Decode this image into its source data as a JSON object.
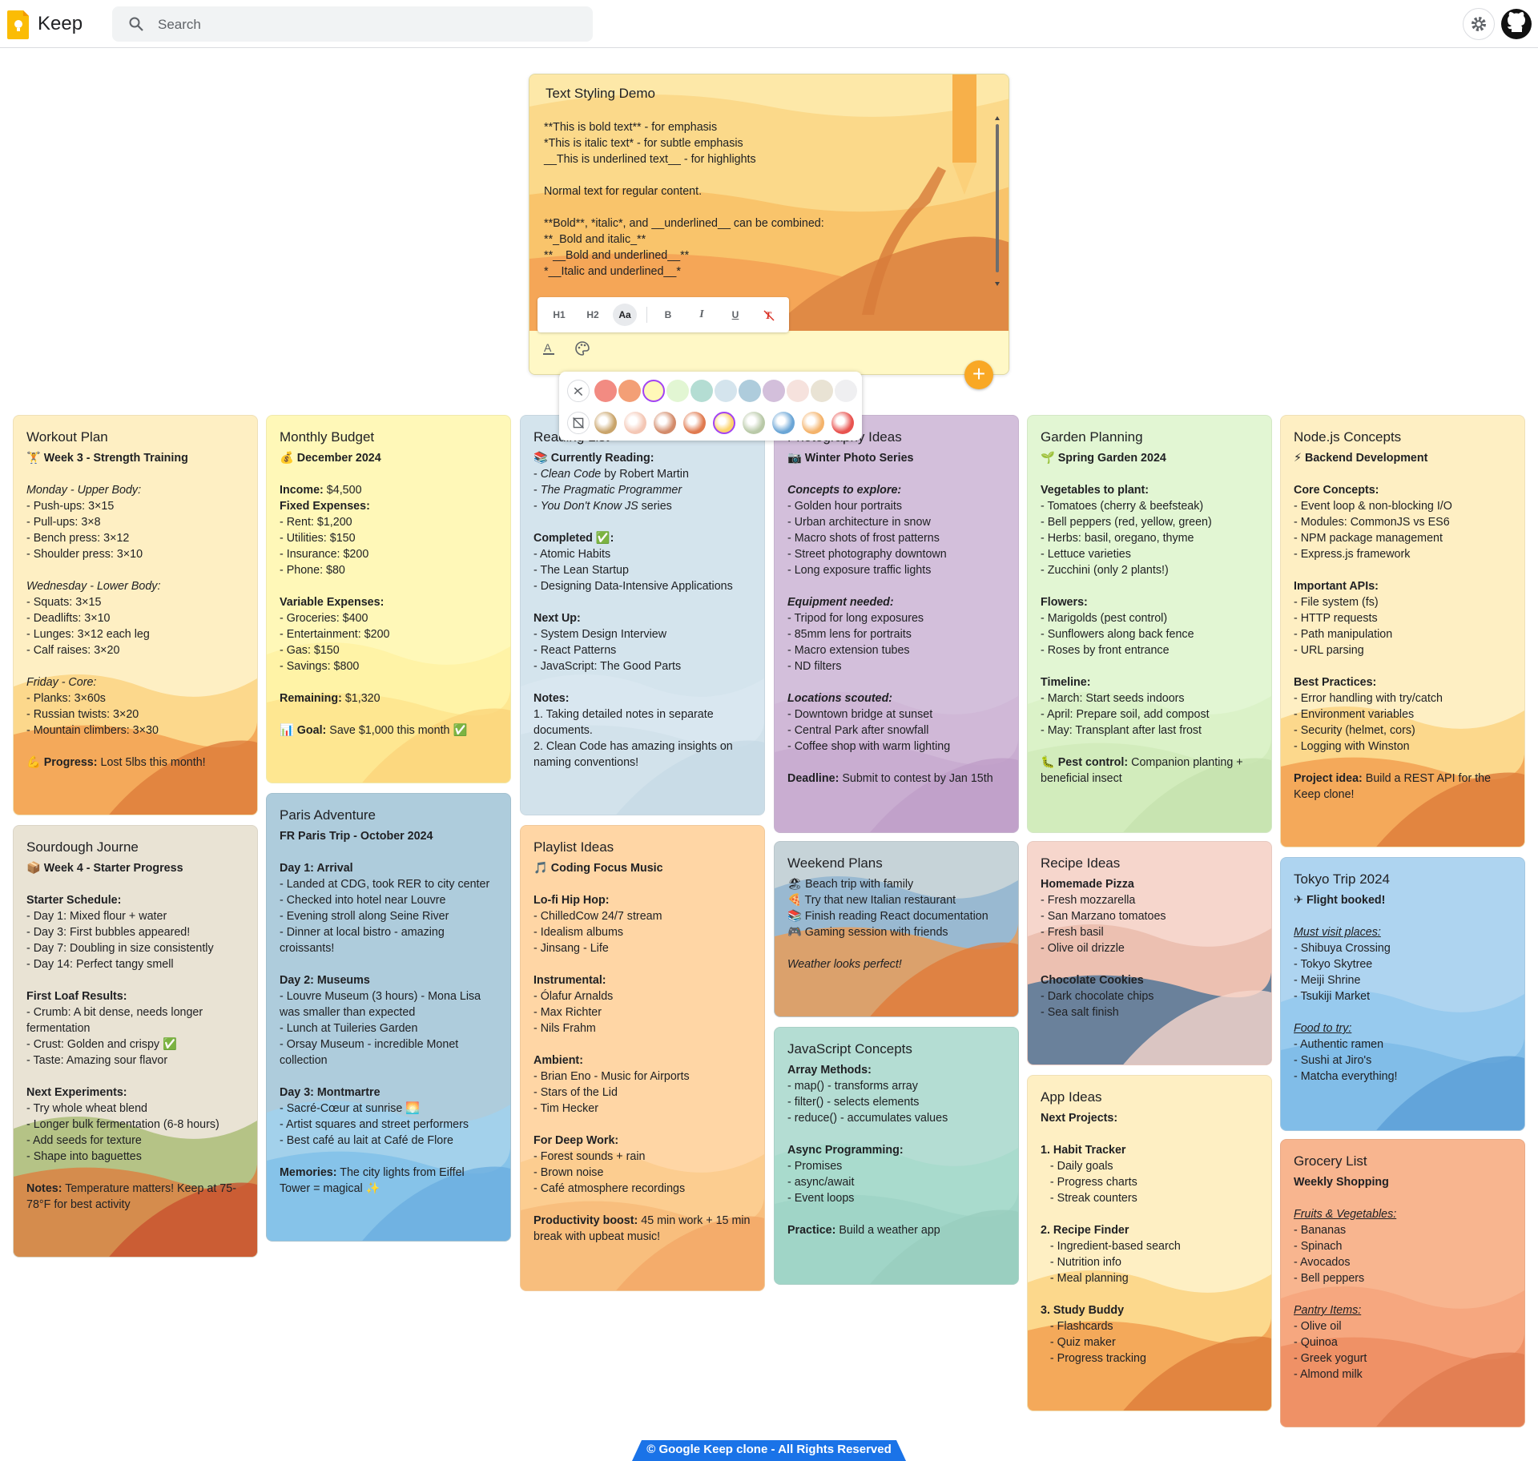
{
  "header": {
    "app_name": "Keep",
    "search_placeholder": "Search",
    "settings_icon": "gear-icon",
    "github_icon": "github-icon"
  },
  "editor": {
    "title": "Text Styling Demo",
    "body": "**This is bold text** - for emphasis\n*This is italic text* - for subtle emphasis\n__This is underlined text__ - for highlights\n\nNormal text for regular content.\n\n**Bold**, *italic*, and __underlined__ can be combined:\n**_Bold and italic_**\n**__Bold and underlined__**\n*__Italic and underlined__*",
    "toolbar": [
      "H1",
      "H2",
      "Aa",
      "B",
      "I",
      "U",
      "Clear"
    ],
    "active_tool": "Aa"
  },
  "palette": {
    "colors": [
      "#f28b82",
      "#f39f76",
      "#fff8b8",
      "#e2f6d3",
      "#b4ddd3",
      "#d4e4ed",
      "#aeccdc",
      "#d3bfdb",
      "#f6e2dd",
      "#e9e3d4",
      "#efeff1"
    ],
    "selected_color": "#fff8b8",
    "backgrounds": [
      "groceries",
      "food",
      "music",
      "recipes",
      "notes",
      "places",
      "travel",
      "video",
      "celebration"
    ],
    "selected_background": "notes"
  },
  "notes": [
    {
      "title": "Workout Plan",
      "bg": "#feefc3",
      "lines": [
        {
          "t": "🏋 Week 3 - Strength Training",
          "s": "b"
        },
        {
          "t": "",
          "s": "gap"
        },
        {
          "t": "Monday - Upper Body:",
          "s": "i"
        },
        {
          "t": "- Push-ups: 3×15"
        },
        {
          "t": "- Pull-ups: 3×8"
        },
        {
          "t": "- Bench press: 3×12"
        },
        {
          "t": "- Shoulder press: 3×10"
        },
        {
          "t": "",
          "s": "gap"
        },
        {
          "t": "Wednesday - Lower Body:",
          "s": "i"
        },
        {
          "t": "- Squats: 3×15"
        },
        {
          "t": "- Deadlifts: 3×10"
        },
        {
          "t": "- Lunges: 3×12 each leg"
        },
        {
          "t": "- Calf raises: 3×20"
        },
        {
          "t": "",
          "s": "gap"
        },
        {
          "t": "Friday - Core:",
          "s": "i"
        },
        {
          "t": "- Planks: 3×60s"
        },
        {
          "t": "- Russian twists: 3×20"
        },
        {
          "t": "- Mountain climbers: 3×30"
        },
        {
          "t": "",
          "s": "gap"
        },
        {
          "t": "💪 Progress: Lost 5lbs this month!",
          "s": "mix",
          "k": "💪 Progress:"
        }
      ]
    },
    {
      "title": "Monthly Budget",
      "bg": "#fff8b8",
      "lines": [
        {
          "t": "💰 December 2024",
          "s": "b"
        },
        {
          "t": "",
          "s": "gap"
        },
        {
          "t": "Income: $4,500",
          "s": "mix",
          "k": "Income:"
        },
        {
          "t": "Fixed Expenses:",
          "s": "b"
        },
        {
          "t": "- Rent: $1,200"
        },
        {
          "t": "- Utilities: $150"
        },
        {
          "t": "- Insurance: $200"
        },
        {
          "t": "- Phone: $80"
        },
        {
          "t": "",
          "s": "gap"
        },
        {
          "t": "Variable Expenses:",
          "s": "b"
        },
        {
          "t": "- Groceries: $400"
        },
        {
          "t": "- Entertainment: $200"
        },
        {
          "t": "- Gas: $150"
        },
        {
          "t": "- Savings: $800"
        },
        {
          "t": "",
          "s": "gap"
        },
        {
          "t": "Remaining: $1,320",
          "s": "mix",
          "k": "Remaining:"
        },
        {
          "t": "",
          "s": "gap"
        },
        {
          "t": "📊 Goal: Save $1,000 this month ✅",
          "s": "mix",
          "k": "📊 Goal:"
        }
      ]
    },
    {
      "title": "Reading List",
      "bg": "#d4e4ed",
      "lines": [
        {
          "t": "📚 Currently Reading:",
          "s": "b"
        },
        {
          "t": "- Clean Code by Robert Martin",
          "s": "mixi",
          "k": "Clean Code"
        },
        {
          "t": "- The Pragmatic Programmer",
          "s": "mixi",
          "k": "The Pragmatic Programmer"
        },
        {
          "t": "- You Don't Know JS series",
          "s": "mixi",
          "k": "You Don't Know JS"
        },
        {
          "t": "",
          "s": "gap"
        },
        {
          "t": "Completed ✅:",
          "s": "b"
        },
        {
          "t": "- Atomic Habits"
        },
        {
          "t": "- The Lean Startup"
        },
        {
          "t": "- Designing Data-Intensive Applications"
        },
        {
          "t": "",
          "s": "gap"
        },
        {
          "t": "Next Up:",
          "s": "b"
        },
        {
          "t": "- System Design Interview"
        },
        {
          "t": "- React Patterns"
        },
        {
          "t": "- JavaScript: The Good Parts"
        },
        {
          "t": "",
          "s": "gap"
        },
        {
          "t": "Notes:",
          "s": "b"
        },
        {
          "t": "1. Taking detailed notes in separate documents."
        },
        {
          "t": "2. Clean Code has amazing insights on naming conventions!"
        }
      ]
    },
    {
      "title": "Photography Ideas",
      "bg": "#d3bfdb",
      "lines": [
        {
          "t": "📷 Winter Photo Series",
          "s": "b"
        },
        {
          "t": "",
          "s": "gap"
        },
        {
          "t": "Concepts to explore:",
          "s": "bi"
        },
        {
          "t": "- Golden hour portraits"
        },
        {
          "t": "- Urban architecture in snow"
        },
        {
          "t": "- Macro shots of frost patterns"
        },
        {
          "t": "- Street photography downtown"
        },
        {
          "t": "- Long exposure traffic lights"
        },
        {
          "t": "",
          "s": "gap"
        },
        {
          "t": "Equipment needed:",
          "s": "bi"
        },
        {
          "t": "- Tripod for long exposures"
        },
        {
          "t": "- 85mm lens for portraits"
        },
        {
          "t": "- Macro extension tubes"
        },
        {
          "t": "- ND filters"
        },
        {
          "t": "",
          "s": "gap"
        },
        {
          "t": "Locations scouted:",
          "s": "bi"
        },
        {
          "t": "- Downtown bridge at sunset"
        },
        {
          "t": "- Central Park after snowfall"
        },
        {
          "t": "- Coffee shop with warm lighting"
        },
        {
          "t": "",
          "s": "gap"
        },
        {
          "t": "Deadline: Submit to contest by Jan 15th",
          "s": "mix",
          "k": "Deadline:"
        }
      ]
    },
    {
      "title": "Garden Planning",
      "bg": "#e2f6d3",
      "lines": [
        {
          "t": "🌱 Spring Garden 2024",
          "s": "b"
        },
        {
          "t": "",
          "s": "gap"
        },
        {
          "t": "Vegetables to plant:",
          "s": "b"
        },
        {
          "t": "- Tomatoes (cherry & beefsteak)"
        },
        {
          "t": "- Bell peppers (red, yellow, green)"
        },
        {
          "t": "- Herbs: basil, oregano, thyme"
        },
        {
          "t": "- Lettuce varieties"
        },
        {
          "t": "- Zucchini (only 2 plants!)"
        },
        {
          "t": "",
          "s": "gap"
        },
        {
          "t": "Flowers:",
          "s": "b"
        },
        {
          "t": "- Marigolds (pest control)"
        },
        {
          "t": "- Sunflowers along back fence"
        },
        {
          "t": "- Roses by front entrance"
        },
        {
          "t": "",
          "s": "gap"
        },
        {
          "t": "Timeline:",
          "s": "b"
        },
        {
          "t": "- March: Start seeds indoors"
        },
        {
          "t": "- April: Prepare soil, add compost"
        },
        {
          "t": "- May: Transplant after last frost"
        },
        {
          "t": "",
          "s": "gap"
        },
        {
          "t": "🐛 Pest control: Companion planting + beneficial insect",
          "s": "mix",
          "k": "🐛 Pest control:"
        }
      ]
    },
    {
      "title": "Node.js Concepts",
      "bg": "#feefc3",
      "lines": [
        {
          "t": "⚡ Backend Development",
          "s": "b"
        },
        {
          "t": "",
          "s": "gap"
        },
        {
          "t": "Core Concepts:",
          "s": "b"
        },
        {
          "t": "- Event loop & non-blocking I/O"
        },
        {
          "t": "- Modules: CommonJS vs ES6"
        },
        {
          "t": "- NPM package management"
        },
        {
          "t": "- Express.js framework"
        },
        {
          "t": "",
          "s": "gap"
        },
        {
          "t": "Important APIs:",
          "s": "b"
        },
        {
          "t": "- File system (fs)"
        },
        {
          "t": "- HTTP requests"
        },
        {
          "t": "- Path manipulation"
        },
        {
          "t": "- URL parsing"
        },
        {
          "t": "",
          "s": "gap"
        },
        {
          "t": "Best Practices:",
          "s": "b"
        },
        {
          "t": "- Error handling with try/catch"
        },
        {
          "t": "- Environment variables"
        },
        {
          "t": "- Security (helmet, cors)"
        },
        {
          "t": "- Logging with Winston"
        },
        {
          "t": "",
          "s": "gap"
        },
        {
          "t": "Project idea: Build a REST API for the Keep clone!",
          "s": "mix",
          "k": "Project idea:"
        }
      ]
    },
    {
      "title": "Sourdough Journe",
      "bg": "#e9e3d4",
      "lines": [
        {
          "t": "📦 Week 4 - Starter Progress",
          "s": "b"
        },
        {
          "t": "",
          "s": "gap"
        },
        {
          "t": "Starter Schedule:",
          "s": "b"
        },
        {
          "t": "- Day 1: Mixed flour + water"
        },
        {
          "t": "- Day 3: First bubbles appeared!"
        },
        {
          "t": "- Day 7: Doubling in size consistently"
        },
        {
          "t": "- Day 14: Perfect tangy smell"
        },
        {
          "t": "",
          "s": "gap"
        },
        {
          "t": "First Loaf Results:",
          "s": "b"
        },
        {
          "t": "- Crumb: A bit dense, needs longer fermentation"
        },
        {
          "t": "- Crust: Golden and crispy ✅"
        },
        {
          "t": "- Taste: Amazing sour flavor"
        },
        {
          "t": "",
          "s": "gap"
        },
        {
          "t": "Next Experiments:",
          "s": "b"
        },
        {
          "t": "- Try whole wheat blend"
        },
        {
          "t": "- Longer bulk fermentation (6-8 hours)"
        },
        {
          "t": "- Add seeds for texture"
        },
        {
          "t": "- Shape into baguettes"
        },
        {
          "t": "",
          "s": "gap"
        },
        {
          "t": "Notes: Temperature matters! Keep at 75-78°F for best activity",
          "s": "mix",
          "k": "Notes:"
        }
      ]
    },
    {
      "title": "Paris Adventure",
      "bg": "#aeccdc",
      "lines": [
        {
          "t": "FR Paris Trip - October 2024",
          "s": "b"
        },
        {
          "t": "",
          "s": "gap"
        },
        {
          "t": "Day 1: Arrival",
          "s": "b"
        },
        {
          "t": "- Landed at CDG, took RER to city center"
        },
        {
          "t": "- Checked into hotel near Louvre"
        },
        {
          "t": "- Evening stroll along Seine River"
        },
        {
          "t": "- Dinner at local bistro - amazing croissants!"
        },
        {
          "t": "",
          "s": "gap"
        },
        {
          "t": "Day 2: Museums",
          "s": "b"
        },
        {
          "t": "- Louvre Museum (3 hours) - Mona Lisa was smaller than expected"
        },
        {
          "t": "- Lunch at Tuileries Garden"
        },
        {
          "t": "- Orsay Museum - incredible Monet collection"
        },
        {
          "t": "",
          "s": "gap"
        },
        {
          "t": "Day 3: Montmartre",
          "s": "b"
        },
        {
          "t": "- Sacré-Cœur at sunrise 🌅"
        },
        {
          "t": "- Artist squares and street performers"
        },
        {
          "t": "- Best café au lait at Café de Flore"
        },
        {
          "t": "",
          "s": "gap"
        },
        {
          "t": "Memories: The city lights from Eiffel Tower = magical ✨",
          "s": "mix",
          "k": "Memories:"
        }
      ]
    },
    {
      "title": "Playlist Ideas",
      "bg": "#ffd6a5",
      "lines": [
        {
          "t": "🎵 Coding Focus Music",
          "s": "b"
        },
        {
          "t": "",
          "s": "gap"
        },
        {
          "t": "Lo-fi Hip Hop:",
          "s": "b"
        },
        {
          "t": "- ChilledCow 24/7 stream"
        },
        {
          "t": "- Idealism albums"
        },
        {
          "t": "- Jinsang - Life"
        },
        {
          "t": "",
          "s": "gap"
        },
        {
          "t": "Instrumental:",
          "s": "b"
        },
        {
          "t": "- Ólafur Arnalds"
        },
        {
          "t": "- Max Richter"
        },
        {
          "t": "- Nils Frahm"
        },
        {
          "t": "",
          "s": "gap"
        },
        {
          "t": "Ambient:",
          "s": "b"
        },
        {
          "t": "- Brian Eno - Music for Airports"
        },
        {
          "t": "- Stars of the Lid"
        },
        {
          "t": "- Tim Hecker"
        },
        {
          "t": "",
          "s": "gap"
        },
        {
          "t": "For Deep Work:",
          "s": "b"
        },
        {
          "t": "- Forest sounds + rain"
        },
        {
          "t": "- Brown noise"
        },
        {
          "t": "- Café atmosphere recordings"
        },
        {
          "t": "",
          "s": "gap"
        },
        {
          "t": "Productivity boost: 45 min work + 15 min break with upbeat music!",
          "s": "mix",
          "k": "Productivity boost:"
        }
      ]
    },
    {
      "title": "Weekend Plans",
      "bg": "#c6d3d8",
      "lines": [
        {
          "t": "🏖 Beach trip with family"
        },
        {
          "t": "🍕 Try that new Italian restaurant"
        },
        {
          "t": "📚 Finish reading React documentation"
        },
        {
          "t": "🎮 Gaming session with friends"
        },
        {
          "t": "",
          "s": "gap"
        },
        {
          "t": "Weather looks perfect!",
          "s": "i"
        }
      ]
    },
    {
      "title": "JavaScript Concepts",
      "bg": "#b4ddd3",
      "lines": [
        {
          "t": "Array Methods:",
          "s": "b"
        },
        {
          "t": "- map() - transforms array"
        },
        {
          "t": "- filter() - selects elements"
        },
        {
          "t": "- reduce() - accumulates values"
        },
        {
          "t": "",
          "s": "gap"
        },
        {
          "t": "Async Programming:",
          "s": "b"
        },
        {
          "t": "- Promises"
        },
        {
          "t": "- async/await"
        },
        {
          "t": "- Event loops"
        },
        {
          "t": "",
          "s": "gap"
        },
        {
          "t": "Practice: Build a weather app",
          "s": "mix",
          "k": "Practice:"
        }
      ]
    },
    {
      "title": "Recipe Ideas",
      "bg": "#f6d6cc",
      "lines": [
        {
          "t": "Homemade Pizza",
          "s": "b"
        },
        {
          "t": "- Fresh mozzarella"
        },
        {
          "t": "- San Marzano tomatoes"
        },
        {
          "t": "- Fresh basil"
        },
        {
          "t": "- Olive oil drizzle"
        },
        {
          "t": "",
          "s": "gap"
        },
        {
          "t": "Chocolate Cookies",
          "s": "b"
        },
        {
          "t": "- Dark chocolate chips"
        },
        {
          "t": "- Sea salt finish"
        }
      ]
    },
    {
      "title": "App Ideas",
      "bg": "#feefc3",
      "lines": [
        {
          "t": "Next Projects:",
          "s": "b"
        },
        {
          "t": "",
          "s": "gap"
        },
        {
          "t": "1. Habit Tracker",
          "s": "b"
        },
        {
          "t": "   - Daily goals"
        },
        {
          "t": "   - Progress charts"
        },
        {
          "t": "   - Streak counters"
        },
        {
          "t": "",
          "s": "gap"
        },
        {
          "t": "2. Recipe Finder",
          "s": "b"
        },
        {
          "t": "   - Ingredient-based search"
        },
        {
          "t": "   - Nutrition info"
        },
        {
          "t": "   - Meal planning"
        },
        {
          "t": "",
          "s": "gap"
        },
        {
          "t": "3. Study Buddy",
          "s": "b"
        },
        {
          "t": "   - Flashcards"
        },
        {
          "t": "   - Quiz maker"
        },
        {
          "t": "   - Progress tracking"
        }
      ]
    },
    {
      "title": "Tokyo Trip 2024",
      "bg": "#aed4f0",
      "lines": [
        {
          "t": "✈ Flight booked!",
          "s": "b"
        },
        {
          "t": "",
          "s": "gap"
        },
        {
          "t": "Must visit places:",
          "s": "u"
        },
        {
          "t": "- Shibuya Crossing"
        },
        {
          "t": "- Tokyo Skytree"
        },
        {
          "t": "- Meiji Shrine"
        },
        {
          "t": "- Tsukiji Market"
        },
        {
          "t": "",
          "s": "gap"
        },
        {
          "t": "Food to try:",
          "s": "u"
        },
        {
          "t": "- Authentic ramen"
        },
        {
          "t": "- Sushi at Jiro's"
        },
        {
          "t": "- Matcha everything!"
        }
      ]
    },
    {
      "title": "Grocery List",
      "bg": "#f8b58f",
      "lines": [
        {
          "t": "Weekly Shopping",
          "s": "b"
        },
        {
          "t": "",
          "s": "gap"
        },
        {
          "t": "Fruits & Vegetables:",
          "s": "u"
        },
        {
          "t": "- Bananas"
        },
        {
          "t": "- Spinach"
        },
        {
          "t": "- Avocados"
        },
        {
          "t": "- Bell peppers"
        },
        {
          "t": "",
          "s": "gap"
        },
        {
          "t": "Pantry Items:",
          "s": "u"
        },
        {
          "t": "- Olive oil"
        },
        {
          "t": "- Quinoa"
        },
        {
          "t": "- Greek yogurt"
        },
        {
          "t": "- Almond milk"
        }
      ]
    }
  ],
  "footer": {
    "text": "© Google Keep clone - All Rights Reserved"
  }
}
